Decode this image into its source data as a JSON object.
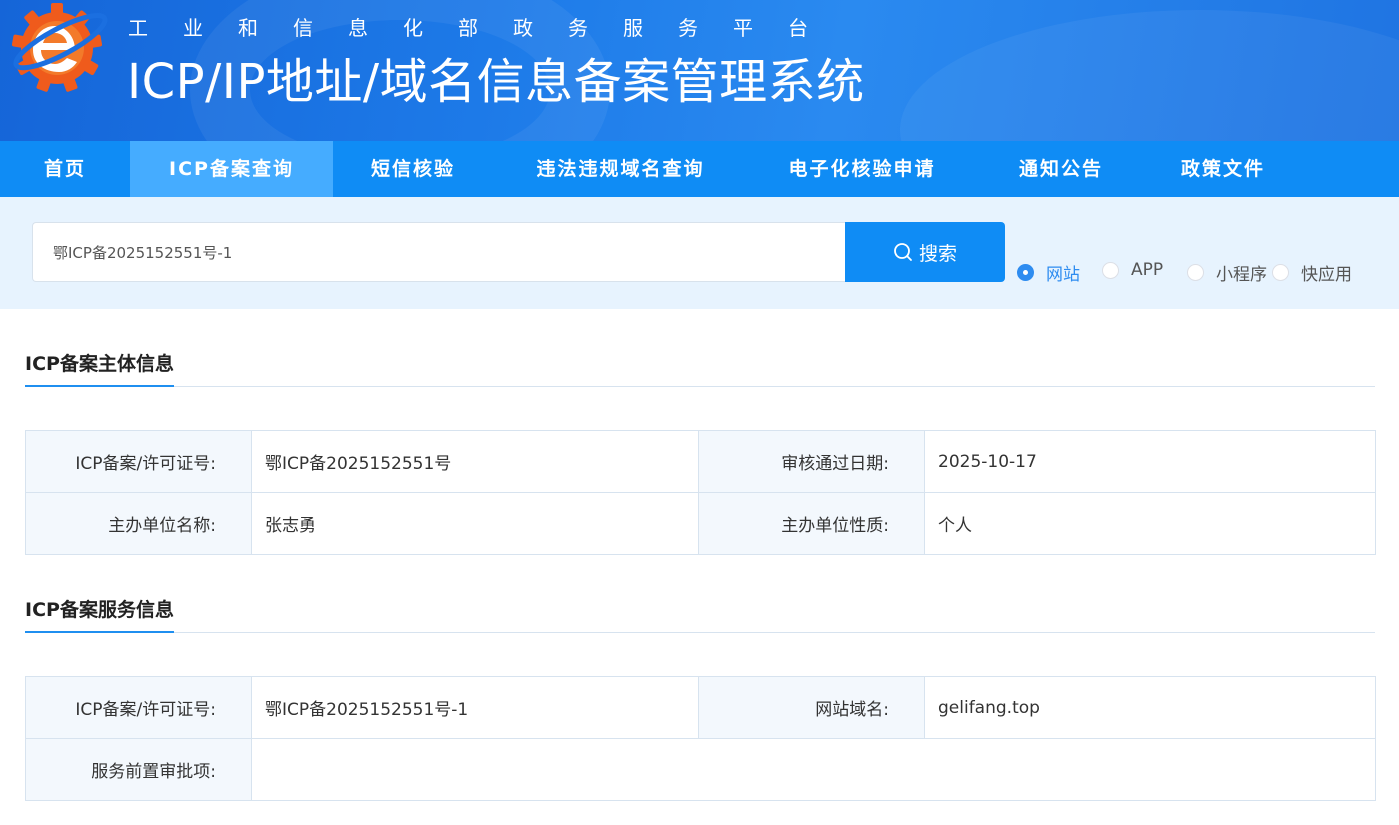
{
  "header": {
    "subtitle": "工业和信息化部政务服务平台",
    "title": "ICP/IP地址/域名信息备案管理系统"
  },
  "nav": {
    "items": [
      {
        "label": "首页"
      },
      {
        "label": "ICP备案查询",
        "active": true
      },
      {
        "label": "短信核验"
      },
      {
        "label": "违法违规域名查询"
      },
      {
        "label": "电子化核验申请"
      },
      {
        "label": "通知公告"
      },
      {
        "label": "政策文件"
      }
    ]
  },
  "search": {
    "value": "鄂ICP备2025152551号-1",
    "button_label": "搜索",
    "types": [
      {
        "label": "网站",
        "checked": true
      },
      {
        "label": "APP",
        "checked": false
      },
      {
        "label": "小程序",
        "checked": false
      },
      {
        "label": "快应用",
        "checked": false
      }
    ]
  },
  "subject_section": {
    "title": "ICP备案主体信息",
    "rows": [
      {
        "label1": "ICP备案/许可证号:",
        "value1": "鄂ICP备2025152551号",
        "label2": "审核通过日期:",
        "value2": "2025-10-17"
      },
      {
        "label1": "主办单位名称:",
        "value1": "张志勇",
        "label2": "主办单位性质:",
        "value2": "个人"
      }
    ]
  },
  "service_section": {
    "title": "ICP备案服务信息",
    "rows": [
      {
        "label1": "ICP备案/许可证号:",
        "value1": "鄂ICP备2025152551号-1",
        "label2": "网站域名:",
        "value2": "gelifang.top"
      },
      {
        "label1": "服务前置审批项:",
        "value1": ""
      }
    ]
  },
  "colors": {
    "header_blue": "#1d7ae8",
    "nav_blue": "#0f8cf5",
    "nav_active": "#45acff",
    "accent": "#2e8cf0",
    "search_band": "#e7f3fe"
  }
}
